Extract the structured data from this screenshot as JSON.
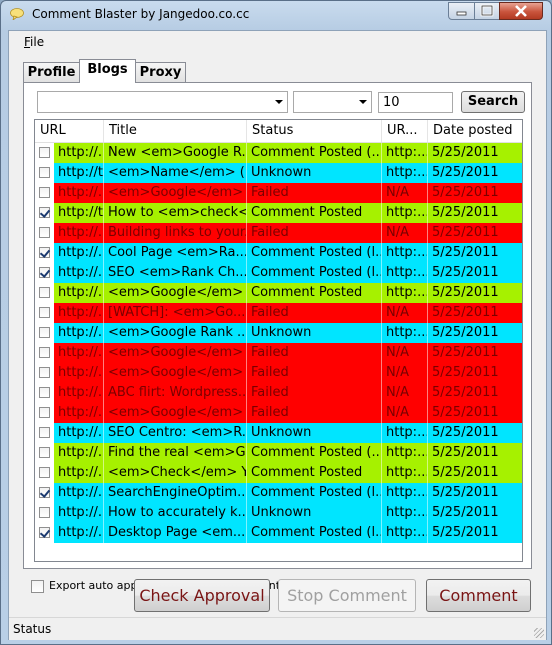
{
  "window": {
    "title": "Comment Blaster by Jangedoo.co.cc",
    "icons": {
      "app": "speech-bubble-icon",
      "minimize": "minimize-icon",
      "maximize": "maximize-icon",
      "close": "close-icon"
    },
    "colors": {
      "close_button": "#c9543c"
    }
  },
  "menu": {
    "file": "File"
  },
  "tabs": [
    {
      "label": "Profile",
      "active": false
    },
    {
      "label": "Blogs",
      "active": true
    },
    {
      "label": "Proxy",
      "active": false
    }
  ],
  "search_bar": {
    "combo1_value": "",
    "combo2_value": "",
    "count_value": "10",
    "search_label": "Search"
  },
  "grid": {
    "columns": [
      "URL",
      "Title",
      "Status",
      "UR...",
      "Date posted"
    ],
    "colors": {
      "posted": "#a6f100",
      "unknown": "#00e5ff",
      "failed": "#ff0000"
    },
    "rows": [
      {
        "checked": false,
        "url": "http://...",
        "title": "New <em>Google R...",
        "status": "Comment Posted (...",
        "ur": "http:...",
        "date": "5/25/2011",
        "state": "posted"
      },
      {
        "checked": false,
        "url": "http://t...",
        "title": "<em>Name</em> (<...",
        "status": "Unknown",
        "ur": "http:...",
        "date": "5/25/2011",
        "state": "unknown"
      },
      {
        "checked": false,
        "url": "http://...",
        "title": "<em>Google</em> ...",
        "status": "Failed",
        "ur": "N/A",
        "date": "5/25/2011",
        "state": "failed"
      },
      {
        "checked": true,
        "url": "http://t...",
        "title": "How to <em>check<...",
        "status": "Comment Posted",
        "ur": "http:...",
        "date": "5/25/2011",
        "state": "posted"
      },
      {
        "checked": false,
        "url": "http://...",
        "title": "Building links to your...",
        "status": "Failed",
        "ur": "N/A",
        "date": "5/25/2011",
        "state": "failed"
      },
      {
        "checked": true,
        "url": "http://...",
        "title": "Cool Page <em>Ra...",
        "status": "Comment Posted (l...",
        "ur": "http:...",
        "date": "5/25/2011",
        "state": "unknown"
      },
      {
        "checked": true,
        "url": "http://...",
        "title": "SEO <em>Rank Ch...",
        "status": "Comment Posted (l...",
        "ur": "http:...",
        "date": "5/25/2011",
        "state": "unknown"
      },
      {
        "checked": false,
        "url": "http://...",
        "title": "<em>Google</em> ...",
        "status": "Comment Posted",
        "ur": "http:...",
        "date": "5/25/2011",
        "state": "posted"
      },
      {
        "checked": false,
        "url": "http://...",
        "title": "[WATCH]: <em>Go...",
        "status": "Failed",
        "ur": "N/A",
        "date": "5/25/2011",
        "state": "failed"
      },
      {
        "checked": false,
        "url": "http://...",
        "title": "<em>Google Rank ...",
        "status": "Unknown",
        "ur": "http:...",
        "date": "5/25/2011",
        "state": "unknown"
      },
      {
        "checked": false,
        "url": "http://...",
        "title": "<em>Google</em> ...",
        "status": "Failed",
        "ur": "N/A",
        "date": "5/25/2011",
        "state": "failed"
      },
      {
        "checked": false,
        "url": "http://...",
        "title": "<em>Google</em> ...",
        "status": "Failed",
        "ur": "N/A",
        "date": "5/25/2011",
        "state": "failed"
      },
      {
        "checked": false,
        "url": "http://...",
        "title": "ABC flirt: Wordpress...",
        "status": "Failed",
        "ur": "N/A",
        "date": "5/25/2011",
        "state": "failed"
      },
      {
        "checked": false,
        "url": "http://...",
        "title": "<em>Google</em> ...",
        "status": "Failed",
        "ur": "N/A",
        "date": "5/25/2011",
        "state": "failed"
      },
      {
        "checked": false,
        "url": "http://...",
        "title": "SEO Centro: <em>R...",
        "status": "Unknown",
        "ur": "http:...",
        "date": "5/25/2011",
        "state": "unknown"
      },
      {
        "checked": false,
        "url": "http://...",
        "title": "Find the real <em>G...",
        "status": "Comment Posted (...",
        "ur": "http:...",
        "date": "5/25/2011",
        "state": "posted"
      },
      {
        "checked": false,
        "url": "http://...",
        "title": "<em>Check</em> Y...",
        "status": "Comment Posted",
        "ur": "http:...",
        "date": "5/25/2011",
        "state": "posted"
      },
      {
        "checked": true,
        "url": "http://...",
        "title": "SearchEngineOptim...",
        "status": "Comment Posted (l...",
        "ur": "http:...",
        "date": "5/25/2011",
        "state": "unknown"
      },
      {
        "checked": false,
        "url": "http://...",
        "title": "How to accurately k...",
        "status": "Unknown",
        "ur": "http:...",
        "date": "5/25/2011",
        "state": "unknown"
      },
      {
        "checked": true,
        "url": "http://...",
        "title": "Desktop Page <em...",
        "status": "Comment Posted (l...",
        "ur": "http:...",
        "date": "5/25/2011",
        "state": "unknown"
      }
    ]
  },
  "footer": {
    "export_label": "Export auto approve blogs after comment finishes",
    "export_checked": false,
    "check_approval_label": "Check Approval",
    "stop_comment_label": "Stop Comment",
    "comment_label": "Comment"
  },
  "status_bar": {
    "text": "Status"
  }
}
